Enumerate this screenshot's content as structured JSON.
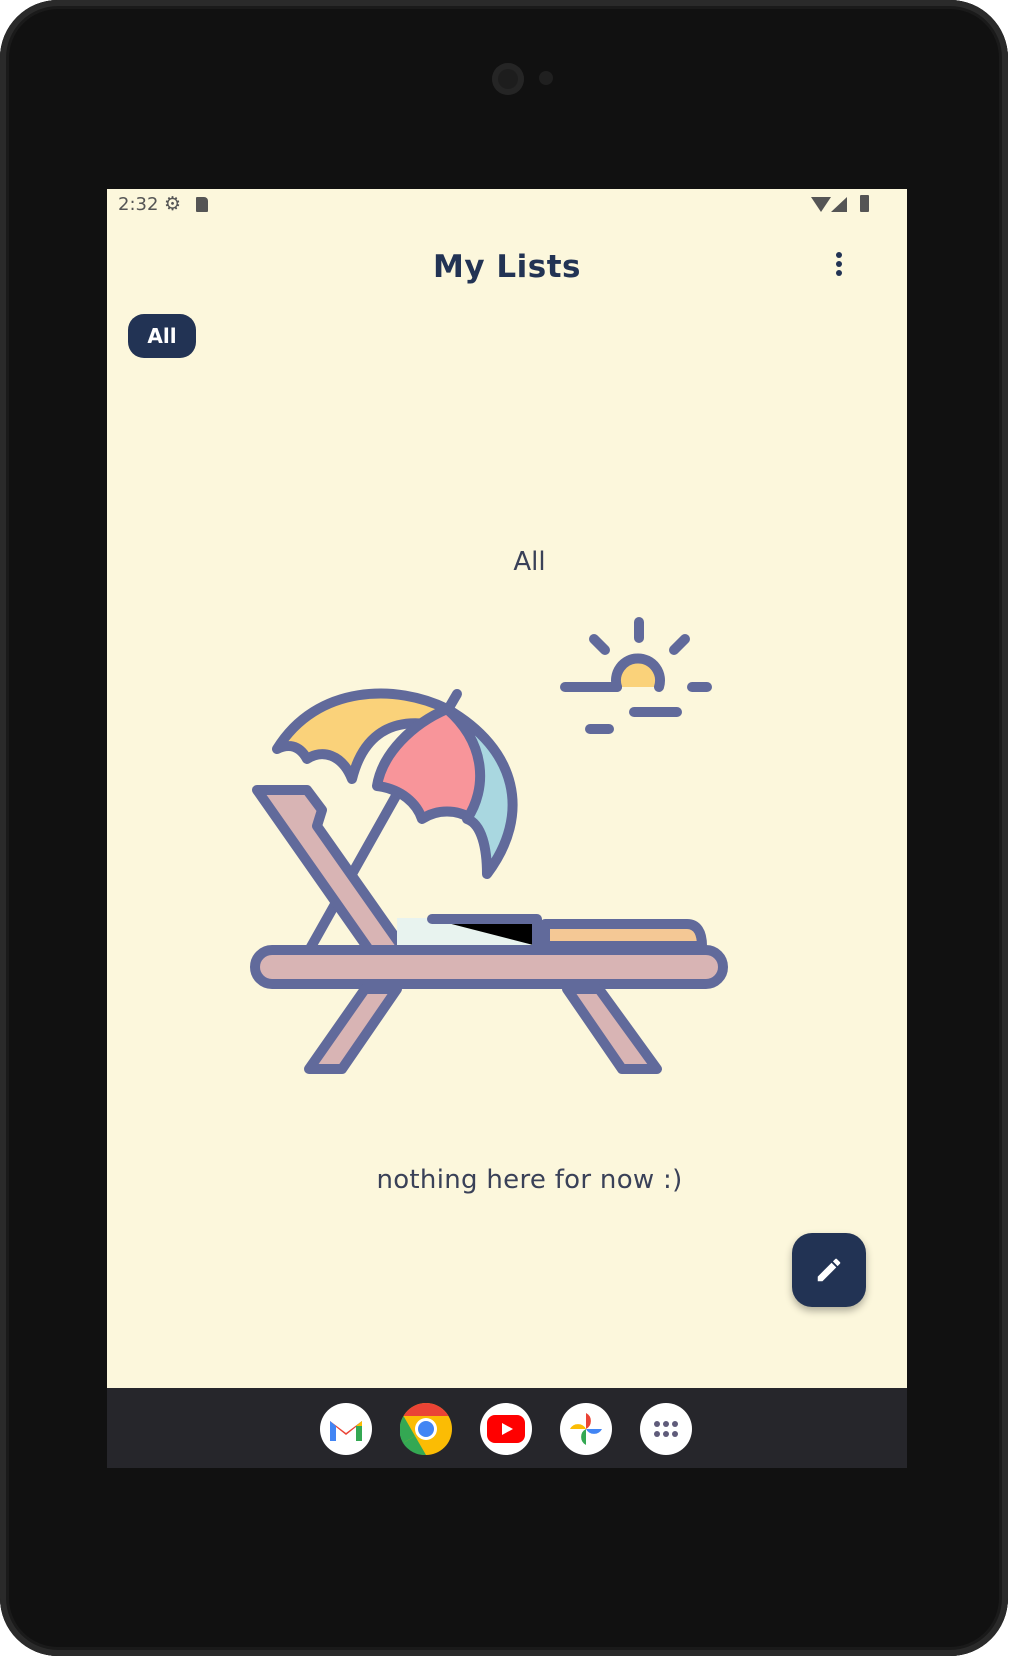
{
  "status_bar": {
    "time": "2:32",
    "icons": [
      "settings-icon",
      "sd-card-icon",
      "wifi-icon",
      "cell-signal-icon",
      "battery-icon"
    ]
  },
  "app_bar": {
    "title": "My Lists",
    "menu_icon": "more-vert-icon"
  },
  "filter_chips": [
    {
      "label": "All",
      "selected": true
    }
  ],
  "content": {
    "section_label": "All",
    "empty_message": "nothing here for now :)",
    "illustration": "beach-chair-umbrella-sun"
  },
  "fab": {
    "icon": "pencil-icon"
  },
  "taskbar": {
    "apps": [
      "gmail-icon",
      "chrome-icon",
      "youtube-icon",
      "photos-icon",
      "app-drawer-icon"
    ]
  },
  "colors": {
    "background": "#fcf7dc",
    "primary": "#223354",
    "illustration_stroke": "#616a9b"
  }
}
